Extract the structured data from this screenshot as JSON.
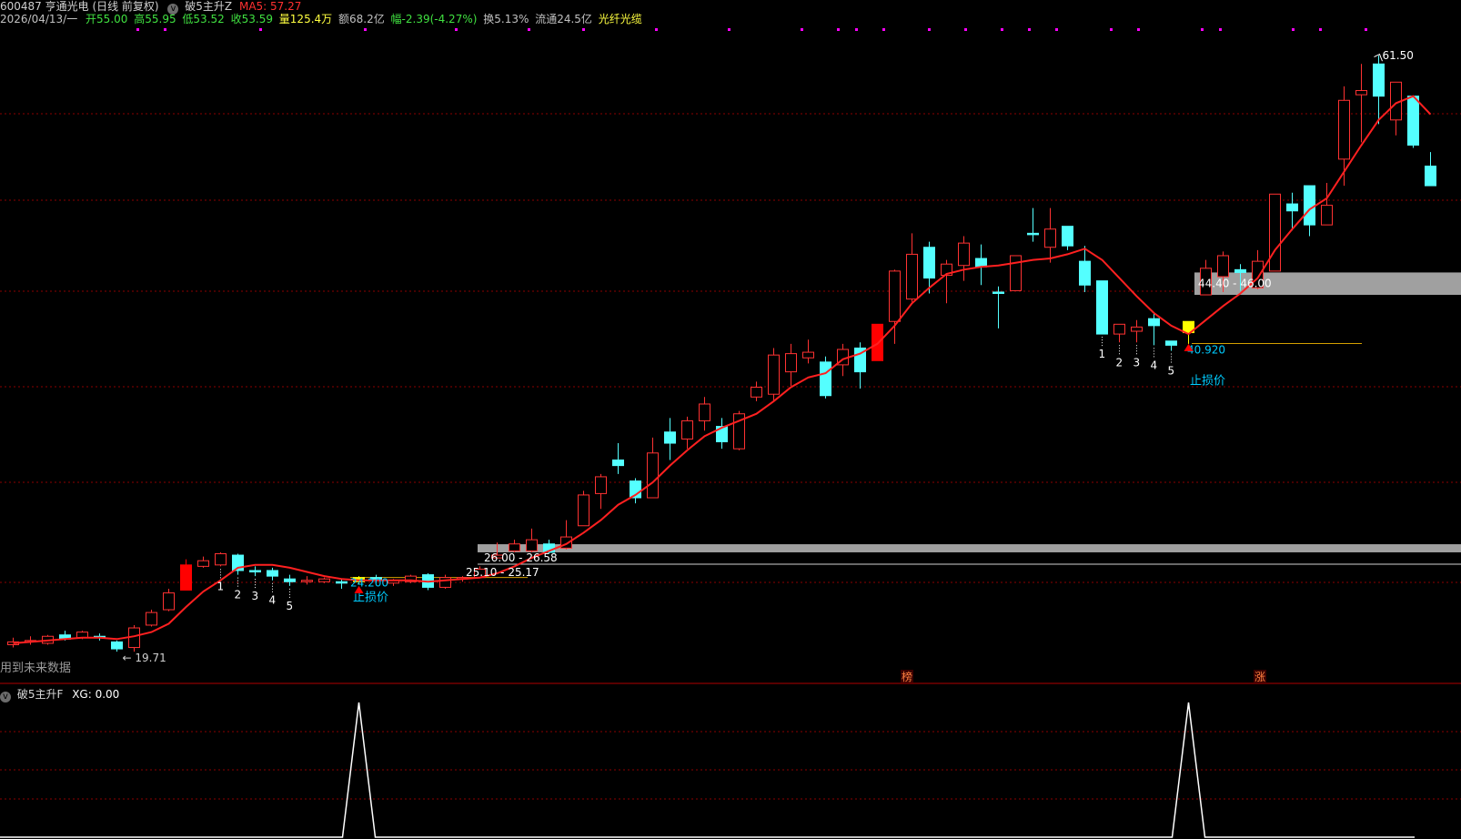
{
  "header": {
    "code_name": "600487 亨通光电 (日线 前复权)",
    "indicator_name": "破5主升Z",
    "ma_label": "MA5: 57.27",
    "date": "2026/04/13/一",
    "open": "开55.00",
    "high": "高55.95",
    "low": "低53.52",
    "close": "收53.59",
    "volume": "量125.4万",
    "amount": "额68.2亿",
    "change": "幅-2.39(-4.27%)",
    "turnover": "换5.13%",
    "float": "流通24.5亿",
    "concept": "光纤光缆",
    "indicator_icon": "chevron-down-icon"
  },
  "sub_header": {
    "title": "破5主升F",
    "value": "XG: 0.00"
  },
  "colors": {
    "up": "#ff3232",
    "down": "#54ffff",
    "signal": "#ffff00",
    "signal_red": "#ff0000",
    "ma": "#ff2020",
    "grid": "#8b0000",
    "zone": "#a0a0a0",
    "text_white": "#ffffff",
    "text_cyan": "#00ccff"
  },
  "chart_data": {
    "type": "candlestick",
    "title": "600487 亨通光电 (日线 前复权)",
    "ylim": [
      18,
      63
    ],
    "ma_name": "MA5",
    "candles": [
      {
        "o": 19.4,
        "c": 19.6,
        "h": 19.9,
        "l": 19.2,
        "k": "up"
      },
      {
        "o": 19.6,
        "c": 19.7,
        "h": 20.0,
        "l": 19.4,
        "k": "up"
      },
      {
        "o": 19.5,
        "c": 20.0,
        "h": 20.1,
        "l": 19.4,
        "k": "up"
      },
      {
        "o": 19.8,
        "c": 20.1,
        "h": 20.4,
        "l": 19.7,
        "k": "down"
      },
      {
        "o": 19.9,
        "c": 20.3,
        "h": 20.4,
        "l": 19.8,
        "k": "up"
      },
      {
        "o": 19.9,
        "c": 20.0,
        "h": 20.2,
        "l": 19.7,
        "k": "down"
      },
      {
        "o": 19.6,
        "c": 19.1,
        "h": 19.7,
        "l": 18.9,
        "k": "down"
      },
      {
        "o": 19.2,
        "c": 20.6,
        "h": 20.8,
        "l": 18.9,
        "k": "up"
      },
      {
        "o": 20.8,
        "c": 21.7,
        "h": 21.9,
        "l": 20.7,
        "k": "up"
      },
      {
        "o": 21.9,
        "c": 23.1,
        "h": 23.4,
        "l": 21.8,
        "k": "up"
      },
      {
        "o": 23.3,
        "c": 25.1,
        "h": 25.5,
        "l": 23.3,
        "k": "signal_red"
      },
      {
        "o": 25.0,
        "c": 25.4,
        "h": 25.7,
        "l": 24.9,
        "k": "up"
      },
      {
        "o": 25.1,
        "c": 25.9,
        "h": 26.0,
        "l": 25.0,
        "k": "up"
      },
      {
        "o": 25.8,
        "c": 24.7,
        "h": 25.9,
        "l": 24.4,
        "k": "down"
      },
      {
        "o": 24.7,
        "c": 24.6,
        "h": 25.0,
        "l": 24.3,
        "k": "down"
      },
      {
        "o": 24.7,
        "c": 24.3,
        "h": 24.9,
        "l": 24.0,
        "k": "down"
      },
      {
        "o": 24.1,
        "c": 23.9,
        "h": 24.4,
        "l": 23.6,
        "k": "down"
      },
      {
        "o": 23.9,
        "c": 24.0,
        "h": 24.3,
        "l": 23.7,
        "k": "up"
      },
      {
        "o": 23.9,
        "c": 24.1,
        "h": 24.2,
        "l": 23.8,
        "k": "up"
      },
      {
        "o": 23.9,
        "c": 23.8,
        "h": 24.1,
        "l": 23.4,
        "k": "down"
      },
      {
        "o": 23.9,
        "c": 24.2,
        "h": 24.3,
        "l": 23.7,
        "k": "signal"
      },
      {
        "o": 24.2,
        "c": 24.0,
        "h": 24.4,
        "l": 23.8,
        "k": "down"
      },
      {
        "o": 23.8,
        "c": 24.0,
        "h": 24.1,
        "l": 23.6,
        "k": "up"
      },
      {
        "o": 23.9,
        "c": 24.3,
        "h": 24.4,
        "l": 23.8,
        "k": "up"
      },
      {
        "o": 24.4,
        "c": 23.5,
        "h": 24.5,
        "l": 23.3,
        "k": "down"
      },
      {
        "o": 23.5,
        "c": 24.2,
        "h": 24.4,
        "l": 23.4,
        "k": "up"
      },
      {
        "o": 24.1,
        "c": 24.2,
        "h": 24.3,
        "l": 23.9,
        "k": "up"
      },
      {
        "o": 24.2,
        "c": 24.8,
        "h": 25.0,
        "l": 24.2,
        "k": "up"
      },
      {
        "o": 25.6,
        "c": 25.8,
        "h": 26.7,
        "l": 25.6,
        "k": "up"
      },
      {
        "o": 26.1,
        "c": 26.6,
        "h": 26.9,
        "l": 26.0,
        "k": "up"
      },
      {
        "o": 26.1,
        "c": 26.9,
        "h": 27.7,
        "l": 26.0,
        "k": "up"
      },
      {
        "o": 26.6,
        "c": 26.0,
        "h": 26.9,
        "l": 25.9,
        "k": "down"
      },
      {
        "o": 26.3,
        "c": 27.1,
        "h": 28.3,
        "l": 26.2,
        "k": "up"
      },
      {
        "o": 27.9,
        "c": 30.1,
        "h": 30.4,
        "l": 27.9,
        "k": "up"
      },
      {
        "o": 30.2,
        "c": 31.4,
        "h": 31.6,
        "l": 29.1,
        "k": "up"
      },
      {
        "o": 32.6,
        "c": 32.2,
        "h": 33.8,
        "l": 31.6,
        "k": "down"
      },
      {
        "o": 31.1,
        "c": 29.9,
        "h": 31.3,
        "l": 29.5,
        "k": "down"
      },
      {
        "o": 29.9,
        "c": 33.1,
        "h": 34.2,
        "l": 29.9,
        "k": "up"
      },
      {
        "o": 34.6,
        "c": 33.8,
        "h": 35.6,
        "l": 32.6,
        "k": "down"
      },
      {
        "o": 34.1,
        "c": 35.4,
        "h": 35.7,
        "l": 33.4,
        "k": "up"
      },
      {
        "o": 35.4,
        "c": 36.6,
        "h": 37.1,
        "l": 34.7,
        "k": "up"
      },
      {
        "o": 35.0,
        "c": 33.9,
        "h": 35.6,
        "l": 33.4,
        "k": "down"
      },
      {
        "o": 33.4,
        "c": 35.9,
        "h": 36.1,
        "l": 33.3,
        "k": "up"
      },
      {
        "o": 37.1,
        "c": 37.8,
        "h": 38.2,
        "l": 36.8,
        "k": "up"
      },
      {
        "o": 37.3,
        "c": 40.1,
        "h": 40.6,
        "l": 36.8,
        "k": "up"
      },
      {
        "o": 38.9,
        "c": 40.2,
        "h": 40.9,
        "l": 37.9,
        "k": "up"
      },
      {
        "o": 39.9,
        "c": 40.3,
        "h": 41.2,
        "l": 39.5,
        "k": "up"
      },
      {
        "o": 39.6,
        "c": 37.2,
        "h": 40.0,
        "l": 37.0,
        "k": "down"
      },
      {
        "o": 39.4,
        "c": 40.5,
        "h": 40.9,
        "l": 38.6,
        "k": "up"
      },
      {
        "o": 40.6,
        "c": 38.9,
        "h": 41.0,
        "l": 37.7,
        "k": "down"
      },
      {
        "o": 39.7,
        "c": 42.3,
        "h": 42.3,
        "l": 39.7,
        "k": "signal_red"
      },
      {
        "o": 42.5,
        "c": 46.1,
        "h": 46.2,
        "l": 40.9,
        "k": "up"
      },
      {
        "o": 44.1,
        "c": 47.3,
        "h": 48.8,
        "l": 43.9,
        "k": "up"
      },
      {
        "o": 47.8,
        "c": 45.6,
        "h": 48.2,
        "l": 44.5,
        "k": "down"
      },
      {
        "o": 45.8,
        "c": 46.6,
        "h": 46.9,
        "l": 43.8,
        "k": "up"
      },
      {
        "o": 46.5,
        "c": 48.1,
        "h": 48.6,
        "l": 45.4,
        "k": "up"
      },
      {
        "o": 47.0,
        "c": 46.4,
        "h": 48.0,
        "l": 45.1,
        "k": "down"
      },
      {
        "o": 44.6,
        "c": 44.5,
        "h": 45.0,
        "l": 42.0,
        "k": "down"
      },
      {
        "o": 44.7,
        "c": 47.2,
        "h": 47.2,
        "l": 44.7,
        "k": "up"
      },
      {
        "o": 48.8,
        "c": 48.7,
        "h": 50.6,
        "l": 48.2,
        "k": "down"
      },
      {
        "o": 47.8,
        "c": 49.1,
        "h": 50.6,
        "l": 46.7,
        "k": "up"
      },
      {
        "o": 49.3,
        "c": 47.9,
        "h": 49.3,
        "l": 47.6,
        "k": "down"
      },
      {
        "o": 46.8,
        "c": 45.1,
        "h": 47.9,
        "l": 44.6,
        "k": "down"
      },
      {
        "o": 45.4,
        "c": 41.6,
        "h": 45.4,
        "l": 41.6,
        "k": "down"
      },
      {
        "o": 41.6,
        "c": 42.3,
        "h": 42.3,
        "l": 41.0,
        "k": "up"
      },
      {
        "o": 41.8,
        "c": 42.1,
        "h": 42.6,
        "l": 41.0,
        "k": "up"
      },
      {
        "o": 42.7,
        "c": 42.2,
        "h": 43.1,
        "l": 40.8,
        "k": "down"
      },
      {
        "o": 41.1,
        "c": 40.8,
        "h": 41.1,
        "l": 40.4,
        "k": "down"
      },
      {
        "o": 41.7,
        "c": 42.5,
        "h": 42.5,
        "l": 40.9,
        "k": "signal"
      },
      {
        "o": 44.4,
        "c": 46.3,
        "h": 46.9,
        "l": 44.4,
        "k": "up"
      },
      {
        "o": 45.7,
        "c": 47.2,
        "h": 47.5,
        "l": 44.6,
        "k": "up"
      },
      {
        "o": 46.0,
        "c": 46.2,
        "h": 46.6,
        "l": 44.7,
        "k": "down"
      },
      {
        "o": 44.9,
        "c": 46.8,
        "h": 47.6,
        "l": 44.8,
        "k": "up"
      },
      {
        "o": 46.1,
        "c": 51.6,
        "h": 51.6,
        "l": 46.1,
        "k": "up"
      },
      {
        "o": 50.4,
        "c": 50.9,
        "h": 51.7,
        "l": 49.0,
        "k": "down"
      },
      {
        "o": 52.2,
        "c": 49.4,
        "h": 52.2,
        "l": 48.6,
        "k": "down"
      },
      {
        "o": 49.4,
        "c": 50.8,
        "h": 52.4,
        "l": 49.4,
        "k": "up"
      },
      {
        "o": 54.1,
        "c": 58.3,
        "h": 59.3,
        "l": 52.2,
        "k": "up"
      },
      {
        "o": 58.7,
        "c": 59.0,
        "h": 60.9,
        "l": 55.3,
        "k": "up"
      },
      {
        "o": 60.9,
        "c": 58.6,
        "h": 61.5,
        "l": 56.6,
        "k": "down"
      },
      {
        "o": 56.9,
        "c": 59.6,
        "h": 59.6,
        "l": 55.8,
        "k": "up"
      },
      {
        "o": 58.6,
        "c": 55.1,
        "h": 58.6,
        "l": 54.9,
        "k": "down"
      },
      {
        "o": 53.6,
        "c": 52.2,
        "h": 54.6,
        "l": 52.2,
        "k": "down"
      }
    ],
    "ma5": [
      19.5,
      19.6,
      19.7,
      19.8,
      19.9,
      19.9,
      19.8,
      20.0,
      20.3,
      20.9,
      22.1,
      23.2,
      24.0,
      24.9,
      25.1,
      25.1,
      24.9,
      24.6,
      24.3,
      24.1,
      24.0,
      24.0,
      24.0,
      24.0,
      23.9,
      24.0,
      24.1,
      24.2,
      24.5,
      25.0,
      25.6,
      26.1,
      26.6,
      27.4,
      28.3,
      29.4,
      30.1,
      31.0,
      32.2,
      33.3,
      34.3,
      34.9,
      35.4,
      35.9,
      36.8,
      37.8,
      38.5,
      38.8,
      39.8,
      40.2,
      40.9,
      42.2,
      43.8,
      44.9,
      45.9,
      46.2,
      46.4,
      46.5,
      46.7,
      46.9,
      47.0,
      47.3,
      47.7,
      46.9,
      45.6,
      44.3,
      43.1,
      42.2,
      41.6,
      42.6,
      43.6,
      44.5,
      45.6,
      47.6,
      49.1,
      50.5,
      51.3,
      53.2,
      55.1,
      56.9,
      58.1,
      58.6,
      57.3
    ],
    "ma_end_label": "57.27",
    "annotations": {
      "low_label": "19.71",
      "high_label": "61.50",
      "zone1_label": "26.00 - 26.58",
      "zone2_label": "25.10 - 25.17",
      "zone3_label": "44.40 - 46.00",
      "stop1_value": "24.200",
      "stop1_text": "止损价",
      "stop2_value": "40.920",
      "stop2_text": "止损价",
      "left_note": "用到未来数据",
      "count_labels": [
        "1",
        "2",
        "3",
        "4",
        "5"
      ],
      "bottom_marks": [
        "榜",
        "涨"
      ]
    },
    "sub_series": {
      "name": "XG",
      "spike_indices": [
        20,
        68
      ],
      "ylim": [
        0,
        1
      ]
    }
  }
}
